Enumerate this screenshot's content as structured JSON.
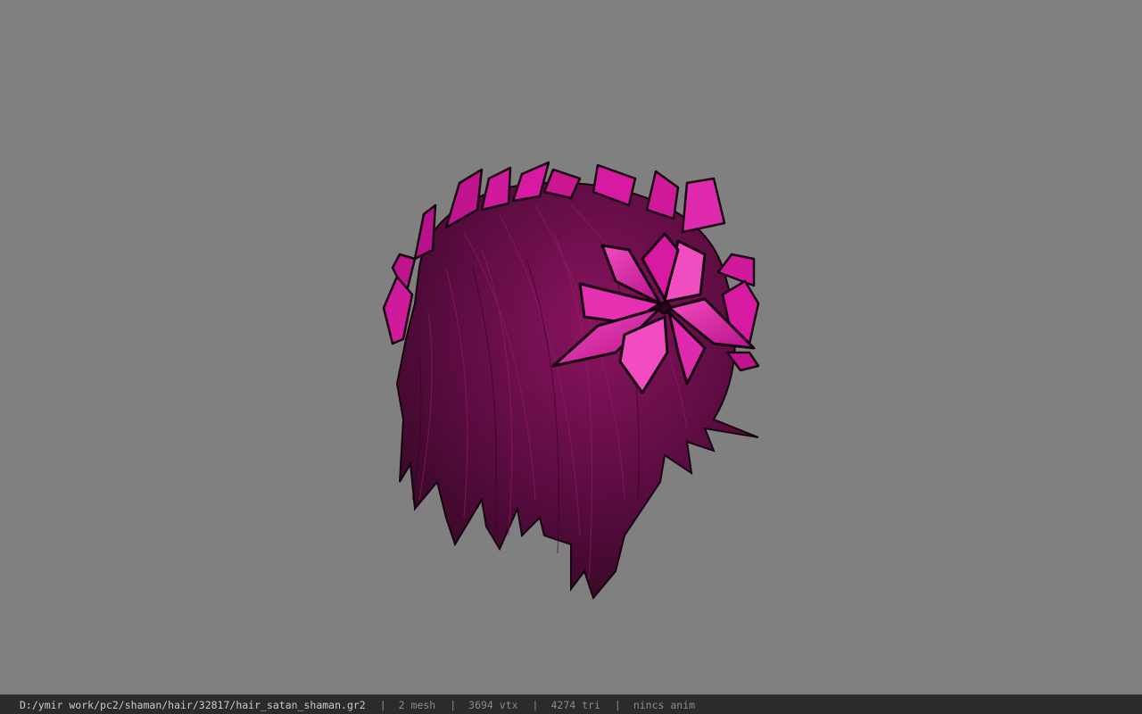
{
  "viewport": {
    "background": "#808080",
    "model_colors": {
      "hair_dark": "#3c0a2a",
      "hair_mid": "#6b0f4b",
      "hair_light": "#9a1a6e",
      "petal": "#d81aa2",
      "petal_light": "#f04ec0",
      "outline": "#160410"
    }
  },
  "status_bar": {
    "path": "D:/ymir work/pc2/shaman/hair/32817/hair_satan_shaman.gr2",
    "separator": "|",
    "mesh": "2 mesh",
    "vtx": "3694 vtx",
    "tri": "4274 tri",
    "anim": "nincs anim"
  }
}
